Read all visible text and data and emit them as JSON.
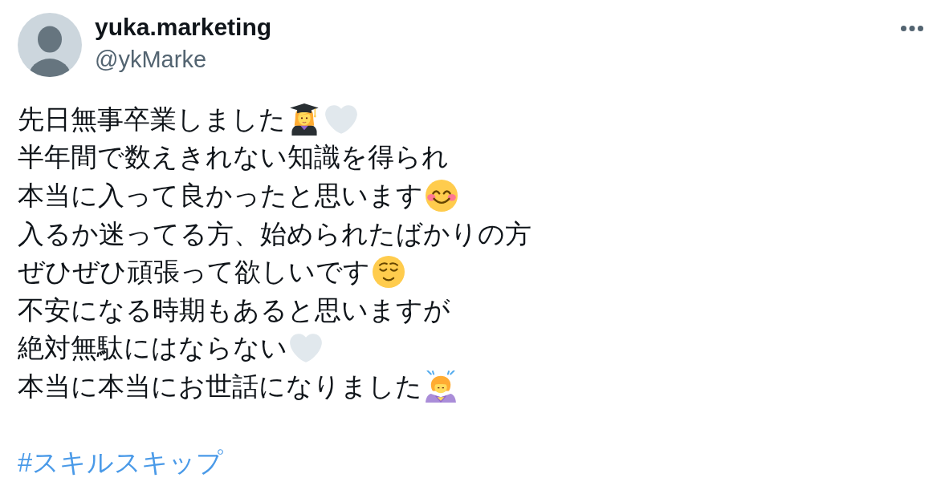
{
  "author": {
    "name": "yuka.marketing",
    "handle": "@ykMarke"
  },
  "tweet": {
    "lines": [
      {
        "text": "先日無事卒業しました",
        "icons": [
          {
            "kind": "graduate"
          },
          {
            "kind": "heart"
          }
        ]
      },
      {
        "text": "半年間で数えきれない知識を得られ"
      },
      {
        "text": "本当に入って良かったと思います",
        "icons": [
          {
            "kind": "smiling"
          }
        ]
      },
      {
        "text": "入るか迷ってる方、始められたばかりの方"
      },
      {
        "text": "ぜひぜひ頑張って欲しいです",
        "icons": [
          {
            "kind": "relieved"
          }
        ]
      },
      {
        "text": "不安になる時期もあると思いますが"
      },
      {
        "text": "絶対無駄にはならない",
        "icons": [
          {
            "kind": "heart"
          }
        ]
      },
      {
        "text": "本当に本当にお世話になりました",
        "icons": [
          {
            "kind": "bowing"
          }
        ]
      }
    ],
    "hashtag": "#スキルスキップ"
  }
}
